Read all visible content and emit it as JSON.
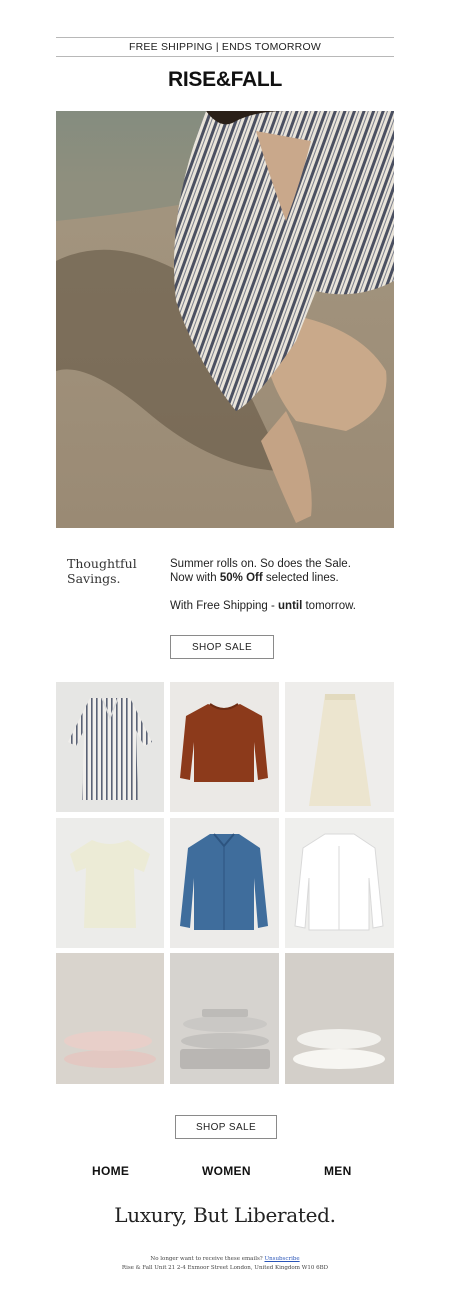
{
  "announcement": "FREE SHIPPING | ENDS TOMORROW",
  "brand": {
    "logo_text": "RISE&FALL"
  },
  "intro": {
    "heading_line1": "Thoughtful",
    "heading_line2": "Savings.",
    "line1": "Summer rolls on. So does the Sale.",
    "line2_prefix": "Now with ",
    "line2_bold": "50% Off",
    "line2_suffix": " selected lines.",
    "line3_prefix": "With Free Shipping - ",
    "line3_bold": "until",
    "line3_suffix": " tomorrow."
  },
  "cta_primary": "SHOP SALE",
  "cta_secondary": "SHOP SALE",
  "nav": {
    "home": "HOME",
    "women": "WOMEN",
    "men": "MEN"
  },
  "tagline": "Luxury, But Liberated.",
  "footer": {
    "unsub_prefix": "No longer want to receive these emails? ",
    "unsub_link": "Unsubscribe",
    "address": "Rise & Fall Unit 21 2-4 Exmoor Street London, United Kingdom W10 6BD"
  },
  "colors": {
    "accent_link": "#2a55b8",
    "sand": "#9c8a73",
    "product_bg": "#ececea"
  },
  "products": [
    {
      "icon": "striped-shirt-dress-image"
    },
    {
      "icon": "rust-sweater-image"
    },
    {
      "icon": "cream-skirt-image"
    },
    {
      "icon": "cream-tshirt-image"
    },
    {
      "icon": "denim-shirt-image"
    },
    {
      "icon": "white-shirt-image"
    },
    {
      "icon": "pink-pillows-image"
    },
    {
      "icon": "grey-bedding-stack-image"
    },
    {
      "icon": "white-pillows-image"
    }
  ]
}
